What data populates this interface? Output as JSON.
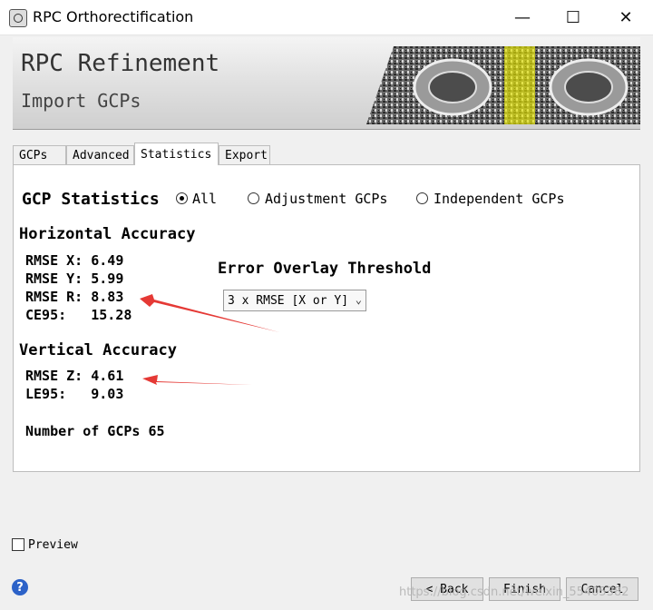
{
  "window": {
    "title": "RPC Orthorectification",
    "minimize": "—",
    "maximize": "☐",
    "close": "✕"
  },
  "banner": {
    "title": "RPC Refinement",
    "subtitle": "Import GCPs"
  },
  "tabs": [
    {
      "label": "GCPs"
    },
    {
      "label": "Advanced"
    },
    {
      "label": "Statistics"
    },
    {
      "label": "Export"
    }
  ],
  "statistics": {
    "heading": "GCP Statistics",
    "filters": [
      {
        "label": "All",
        "selected": true
      },
      {
        "label": "Adjustment GCPs",
        "selected": false
      },
      {
        "label": "Independent GCPs",
        "selected": false
      }
    ],
    "horizontal": {
      "heading": "Horizontal Accuracy",
      "rows": [
        "RMSE X: 6.49",
        "RMSE Y: 5.99",
        "RMSE R: 8.83",
        "CE95:   15.28"
      ]
    },
    "vertical": {
      "heading": "Vertical Accuracy",
      "rows": [
        "RMSE Z: 4.61",
        "LE95:   9.03"
      ]
    },
    "gcp_count": "Number of GCPs 65",
    "overlay": {
      "heading": "Error Overlay Threshold",
      "selected": "3 x RMSE [X or Y]"
    }
  },
  "preview": {
    "label": "Preview",
    "checked": false
  },
  "help_icon": "?",
  "buttons": {
    "back": "< Back",
    "finish": "Finish",
    "cancel": "Cancel"
  },
  "watermark": "https://blog.csdn.net/weixin_55405382",
  "colors": {
    "annotation_arrow": "#e53935",
    "banner_highlight": "#e8e800",
    "help": "#2c62c8"
  }
}
